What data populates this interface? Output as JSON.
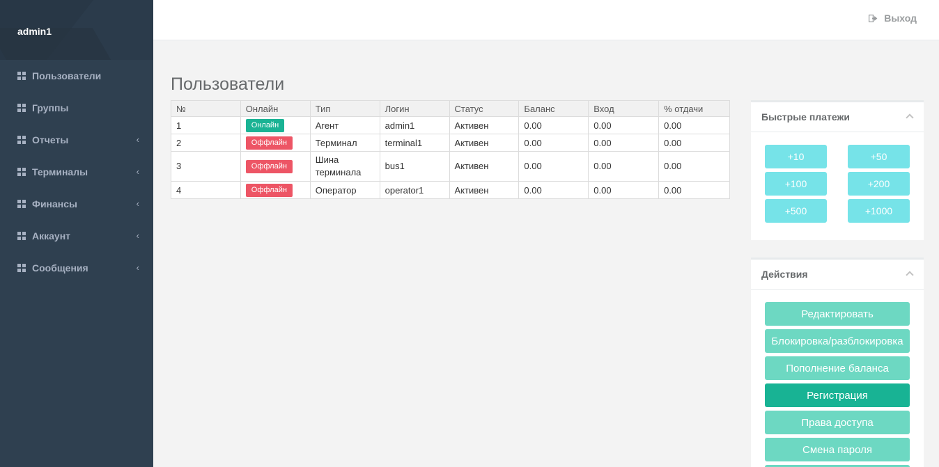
{
  "sidebar": {
    "username": "admin1",
    "items": [
      {
        "label": "Пользователи",
        "has_submenu": false
      },
      {
        "label": "Группы",
        "has_submenu": false
      },
      {
        "label": "Отчеты",
        "has_submenu": true
      },
      {
        "label": "Терминалы",
        "has_submenu": true
      },
      {
        "label": "Финансы",
        "has_submenu": true
      },
      {
        "label": "Аккаунт",
        "has_submenu": true
      },
      {
        "label": "Сообщения",
        "has_submenu": true
      }
    ]
  },
  "header": {
    "logout_label": "Выход"
  },
  "main": {
    "title": "Пользователи",
    "table": {
      "columns": [
        "№",
        "Онлайн",
        "Тип",
        "Логин",
        "Статус",
        "Баланс",
        "Вход",
        "% отдачи"
      ],
      "rows": [
        {
          "num": "1",
          "online": "Онлайн",
          "type": "Агент",
          "login": "admin1",
          "status": "Активен",
          "balance": "0.00",
          "entry": "0.00",
          "payout": "0.00"
        },
        {
          "num": "2",
          "online": "Оффлайн",
          "type": "Терминал",
          "login": "terminal1",
          "status": "Активен",
          "balance": "0.00",
          "entry": "0.00",
          "payout": "0.00"
        },
        {
          "num": "3",
          "online": "Оффлайн",
          "type": "Шина терминала",
          "login": "bus1",
          "status": "Активен",
          "balance": "0.00",
          "entry": "0.00",
          "payout": "0.00"
        },
        {
          "num": "4",
          "online": "Оффлайн",
          "type": "Оператор",
          "login": "operator1",
          "status": "Активен",
          "balance": "0.00",
          "entry": "0.00",
          "payout": "0.00"
        }
      ]
    }
  },
  "quick_payments": {
    "title": "Быстрые платежи",
    "buttons": [
      "+10",
      "+50",
      "+100",
      "+200",
      "+500",
      "+1000"
    ]
  },
  "actions": {
    "title": "Действия",
    "buttons": [
      "Редактировать",
      "Блокировка/разблокировка",
      "Пополнение баланса",
      "Регистрация",
      "Права доступа",
      "Смена пароля"
    ],
    "active_index": 3
  },
  "colors": {
    "sidebar_bg": "#2f4050",
    "online_badge": "#1ab394",
    "offline_badge": "#ed5565",
    "quick_button": "#76e3e8",
    "action_button": "#6dd8c2",
    "action_button_active": "#18b394"
  }
}
